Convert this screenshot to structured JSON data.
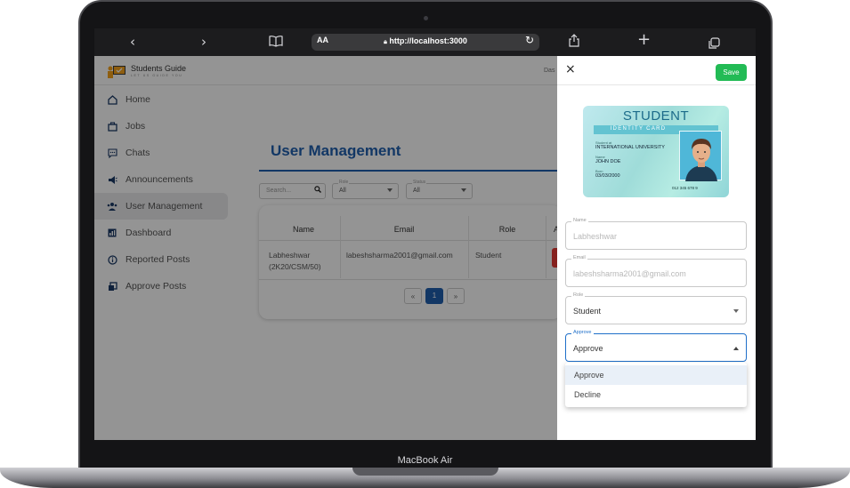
{
  "device": {
    "label": "MacBook Air"
  },
  "browser": {
    "url": "http://localhost:3000",
    "text_size_label": "AA",
    "back_icon": "chevron-left-icon",
    "forward_icon": "chevron-right-icon",
    "bookmarks_icon": "book-icon",
    "share_icon": "share-icon",
    "new_tab_icon": "plus-icon",
    "tabs_icon": "tabs-icon"
  },
  "app": {
    "logo_title": "Students Guide",
    "logo_subtitle": "LET US GUIDE YOU",
    "topbar_truncated": "Das"
  },
  "sidebar": {
    "items": [
      {
        "label": "Home",
        "icon": "home-icon"
      },
      {
        "label": "Jobs",
        "icon": "briefcase-icon"
      },
      {
        "label": "Chats",
        "icon": "chat-icon"
      },
      {
        "label": "Announcements",
        "icon": "megaphone-icon"
      },
      {
        "label": "User Management",
        "icon": "users-icon",
        "active": true
      },
      {
        "label": "Dashboard",
        "icon": "dashboard-icon"
      },
      {
        "label": "Reported Posts",
        "icon": "info-icon"
      },
      {
        "label": "Approve Posts",
        "icon": "copy-icon"
      }
    ]
  },
  "main": {
    "title": "User Management",
    "search_placeholder": "Search...",
    "role_filter": {
      "label": "Role",
      "value": "All"
    },
    "status_filter": {
      "label": "Status",
      "value": "All"
    },
    "table": {
      "columns": [
        "Name",
        "Email",
        "Role",
        "A"
      ],
      "rows": [
        {
          "name_line1": "Labheshwar",
          "name_line2": "(2K20/CSM/50)",
          "email": "labeshsharma2001@gmail.com",
          "role": "Student"
        }
      ]
    },
    "pagination": {
      "prev": "«",
      "current": "1",
      "next": "»"
    }
  },
  "drawer": {
    "close": "×",
    "save": "Save",
    "id_card": {
      "title": "STUDENT",
      "subtitle": "IDENTITY CARD",
      "student_at_label": "Student at",
      "student_at": "INTERNATIONAL UNIVERSITY",
      "name_label": "Name",
      "name": "JOHN DOE",
      "born_label": "Born",
      "born": "03/03/2000",
      "number": "012 345 678 9"
    },
    "fields": {
      "name": {
        "label": "Name",
        "value": "Labheshwar"
      },
      "email": {
        "label": "Email",
        "value": "labeshsharma2001@gmail.com"
      },
      "role": {
        "label": "Role",
        "value": "Student"
      },
      "approve": {
        "label": "Approve",
        "value": "Approve"
      }
    },
    "approve_options": [
      "Approve",
      "Decline"
    ]
  },
  "colors": {
    "accent": "#1f5fae",
    "save": "#22bb55",
    "focus": "#1f6fc9"
  }
}
